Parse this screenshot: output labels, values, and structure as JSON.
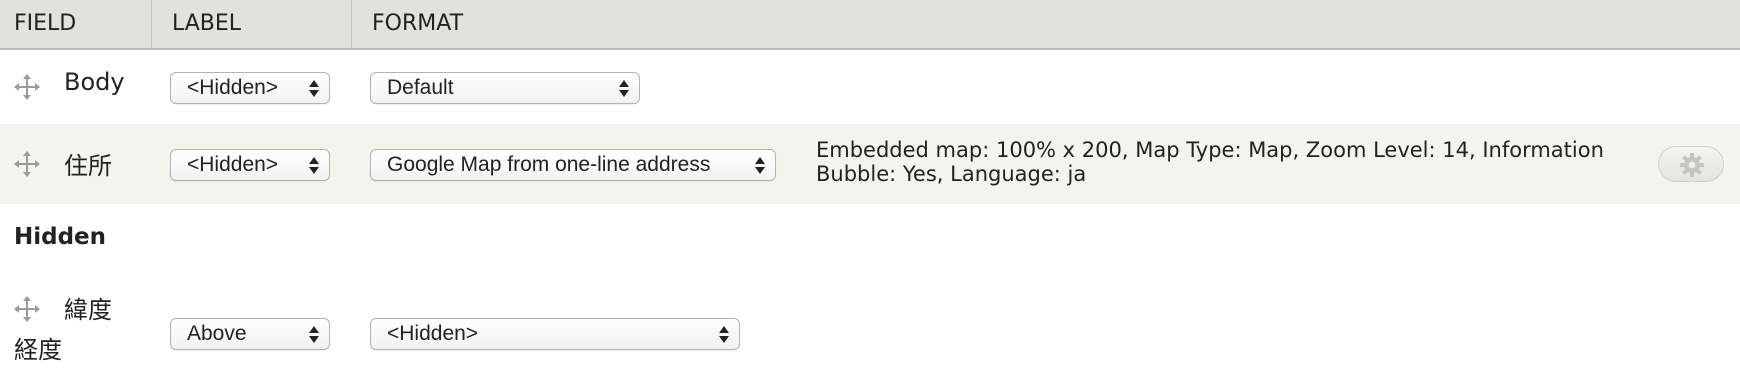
{
  "header": {
    "field": "FIELD",
    "label": "LABEL",
    "format": "FORMAT"
  },
  "rows": [
    {
      "name": "Body",
      "label_select": "<Hidden>",
      "format_select": "Default"
    },
    {
      "name": "住所",
      "label_select": "<Hidden>",
      "format_select": "Google Map from one-line address",
      "summary": "Embedded map: 100% x 200, Map Type: Map, Zoom Level: 14, Information Bubble: Yes, Language: ja",
      "settings_icon": "gear-icon"
    }
  ],
  "hidden_section": {
    "title": "Hidden",
    "rows": [
      {
        "name_line1": "緯度",
        "name_line2": "経度",
        "label_select": "Above",
        "format_select": "<Hidden>"
      }
    ]
  },
  "icons": {
    "drag_handle": "move-icon",
    "select_arrows": "updown-arrows-icon"
  },
  "colors": {
    "header_bg": "#e1e2dc",
    "alt_row_bg": "#f3f4ee"
  }
}
